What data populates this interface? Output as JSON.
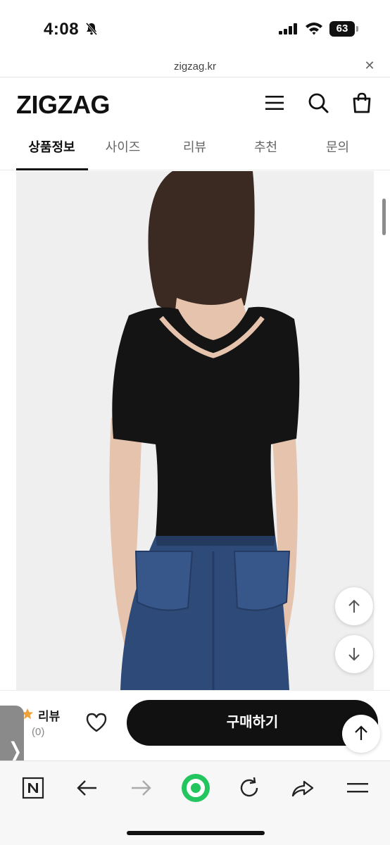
{
  "status_bar": {
    "time": "4:08",
    "battery": "63"
  },
  "url_bar": {
    "domain": "zigzag.kr"
  },
  "header": {
    "logo": "ZIGZAG"
  },
  "tabs": [
    {
      "label": "상품정보",
      "active": true
    },
    {
      "label": "사이즈",
      "active": false
    },
    {
      "label": "리뷰",
      "active": false
    },
    {
      "label": "추천",
      "active": false
    },
    {
      "label": "문의",
      "active": false
    }
  ],
  "purchase_bar": {
    "review_label": "리뷰",
    "review_count": "(0)",
    "buy_label": "구매하기"
  },
  "side_handle": {
    "glyph": "❭"
  },
  "colors": {
    "accent_star": "#f0a23a",
    "buy_button": "#111111",
    "home_ring": "#22c55e"
  }
}
